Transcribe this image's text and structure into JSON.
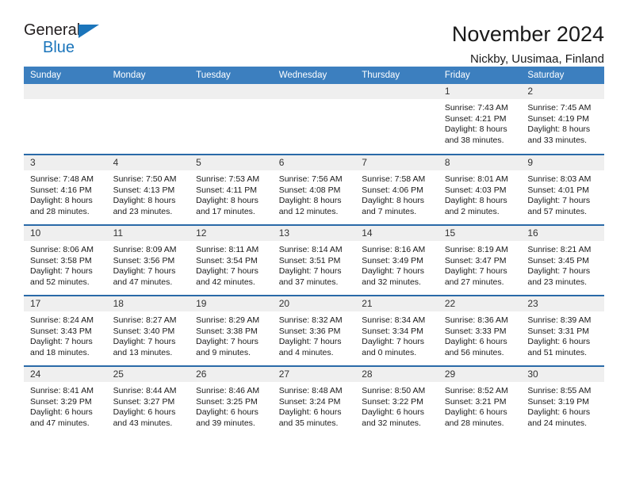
{
  "brand": {
    "name_part1": "General",
    "name_part2": "Blue",
    "accent_color": "#1b75bb"
  },
  "header": {
    "title": "November 2024",
    "subtitle": "Nickby, Uusimaa, Finland"
  },
  "theme": {
    "header_row_bg": "#3c7fbf",
    "row_divider": "#2a6aa8",
    "daynum_bg": "#efefef"
  },
  "weekday_headers": [
    "Sunday",
    "Monday",
    "Tuesday",
    "Wednesday",
    "Thursday",
    "Friday",
    "Saturday"
  ],
  "labels": {
    "sunrise_prefix": "Sunrise:",
    "sunset_prefix": "Sunset:",
    "daylight_prefix": "Daylight:"
  },
  "weeks": [
    [
      {
        "day": "",
        "sunrise": "",
        "sunset": "",
        "daylight_l1": "",
        "daylight_l2": ""
      },
      {
        "day": "",
        "sunrise": "",
        "sunset": "",
        "daylight_l1": "",
        "daylight_l2": ""
      },
      {
        "day": "",
        "sunrise": "",
        "sunset": "",
        "daylight_l1": "",
        "daylight_l2": ""
      },
      {
        "day": "",
        "sunrise": "",
        "sunset": "",
        "daylight_l1": "",
        "daylight_l2": ""
      },
      {
        "day": "",
        "sunrise": "",
        "sunset": "",
        "daylight_l1": "",
        "daylight_l2": ""
      },
      {
        "day": "1",
        "sunrise": "Sunrise: 7:43 AM",
        "sunset": "Sunset: 4:21 PM",
        "daylight_l1": "Daylight: 8 hours",
        "daylight_l2": "and 38 minutes."
      },
      {
        "day": "2",
        "sunrise": "Sunrise: 7:45 AM",
        "sunset": "Sunset: 4:19 PM",
        "daylight_l1": "Daylight: 8 hours",
        "daylight_l2": "and 33 minutes."
      }
    ],
    [
      {
        "day": "3",
        "sunrise": "Sunrise: 7:48 AM",
        "sunset": "Sunset: 4:16 PM",
        "daylight_l1": "Daylight: 8 hours",
        "daylight_l2": "and 28 minutes."
      },
      {
        "day": "4",
        "sunrise": "Sunrise: 7:50 AM",
        "sunset": "Sunset: 4:13 PM",
        "daylight_l1": "Daylight: 8 hours",
        "daylight_l2": "and 23 minutes."
      },
      {
        "day": "5",
        "sunrise": "Sunrise: 7:53 AM",
        "sunset": "Sunset: 4:11 PM",
        "daylight_l1": "Daylight: 8 hours",
        "daylight_l2": "and 17 minutes."
      },
      {
        "day": "6",
        "sunrise": "Sunrise: 7:56 AM",
        "sunset": "Sunset: 4:08 PM",
        "daylight_l1": "Daylight: 8 hours",
        "daylight_l2": "and 12 minutes."
      },
      {
        "day": "7",
        "sunrise": "Sunrise: 7:58 AM",
        "sunset": "Sunset: 4:06 PM",
        "daylight_l1": "Daylight: 8 hours",
        "daylight_l2": "and 7 minutes."
      },
      {
        "day": "8",
        "sunrise": "Sunrise: 8:01 AM",
        "sunset": "Sunset: 4:03 PM",
        "daylight_l1": "Daylight: 8 hours",
        "daylight_l2": "and 2 minutes."
      },
      {
        "day": "9",
        "sunrise": "Sunrise: 8:03 AM",
        "sunset": "Sunset: 4:01 PM",
        "daylight_l1": "Daylight: 7 hours",
        "daylight_l2": "and 57 minutes."
      }
    ],
    [
      {
        "day": "10",
        "sunrise": "Sunrise: 8:06 AM",
        "sunset": "Sunset: 3:58 PM",
        "daylight_l1": "Daylight: 7 hours",
        "daylight_l2": "and 52 minutes."
      },
      {
        "day": "11",
        "sunrise": "Sunrise: 8:09 AM",
        "sunset": "Sunset: 3:56 PM",
        "daylight_l1": "Daylight: 7 hours",
        "daylight_l2": "and 47 minutes."
      },
      {
        "day": "12",
        "sunrise": "Sunrise: 8:11 AM",
        "sunset": "Sunset: 3:54 PM",
        "daylight_l1": "Daylight: 7 hours",
        "daylight_l2": "and 42 minutes."
      },
      {
        "day": "13",
        "sunrise": "Sunrise: 8:14 AM",
        "sunset": "Sunset: 3:51 PM",
        "daylight_l1": "Daylight: 7 hours",
        "daylight_l2": "and 37 minutes."
      },
      {
        "day": "14",
        "sunrise": "Sunrise: 8:16 AM",
        "sunset": "Sunset: 3:49 PM",
        "daylight_l1": "Daylight: 7 hours",
        "daylight_l2": "and 32 minutes."
      },
      {
        "day": "15",
        "sunrise": "Sunrise: 8:19 AM",
        "sunset": "Sunset: 3:47 PM",
        "daylight_l1": "Daylight: 7 hours",
        "daylight_l2": "and 27 minutes."
      },
      {
        "day": "16",
        "sunrise": "Sunrise: 8:21 AM",
        "sunset": "Sunset: 3:45 PM",
        "daylight_l1": "Daylight: 7 hours",
        "daylight_l2": "and 23 minutes."
      }
    ],
    [
      {
        "day": "17",
        "sunrise": "Sunrise: 8:24 AM",
        "sunset": "Sunset: 3:43 PM",
        "daylight_l1": "Daylight: 7 hours",
        "daylight_l2": "and 18 minutes."
      },
      {
        "day": "18",
        "sunrise": "Sunrise: 8:27 AM",
        "sunset": "Sunset: 3:40 PM",
        "daylight_l1": "Daylight: 7 hours",
        "daylight_l2": "and 13 minutes."
      },
      {
        "day": "19",
        "sunrise": "Sunrise: 8:29 AM",
        "sunset": "Sunset: 3:38 PM",
        "daylight_l1": "Daylight: 7 hours",
        "daylight_l2": "and 9 minutes."
      },
      {
        "day": "20",
        "sunrise": "Sunrise: 8:32 AM",
        "sunset": "Sunset: 3:36 PM",
        "daylight_l1": "Daylight: 7 hours",
        "daylight_l2": "and 4 minutes."
      },
      {
        "day": "21",
        "sunrise": "Sunrise: 8:34 AM",
        "sunset": "Sunset: 3:34 PM",
        "daylight_l1": "Daylight: 7 hours",
        "daylight_l2": "and 0 minutes."
      },
      {
        "day": "22",
        "sunrise": "Sunrise: 8:36 AM",
        "sunset": "Sunset: 3:33 PM",
        "daylight_l1": "Daylight: 6 hours",
        "daylight_l2": "and 56 minutes."
      },
      {
        "day": "23",
        "sunrise": "Sunrise: 8:39 AM",
        "sunset": "Sunset: 3:31 PM",
        "daylight_l1": "Daylight: 6 hours",
        "daylight_l2": "and 51 minutes."
      }
    ],
    [
      {
        "day": "24",
        "sunrise": "Sunrise: 8:41 AM",
        "sunset": "Sunset: 3:29 PM",
        "daylight_l1": "Daylight: 6 hours",
        "daylight_l2": "and 47 minutes."
      },
      {
        "day": "25",
        "sunrise": "Sunrise: 8:44 AM",
        "sunset": "Sunset: 3:27 PM",
        "daylight_l1": "Daylight: 6 hours",
        "daylight_l2": "and 43 minutes."
      },
      {
        "day": "26",
        "sunrise": "Sunrise: 8:46 AM",
        "sunset": "Sunset: 3:25 PM",
        "daylight_l1": "Daylight: 6 hours",
        "daylight_l2": "and 39 minutes."
      },
      {
        "day": "27",
        "sunrise": "Sunrise: 8:48 AM",
        "sunset": "Sunset: 3:24 PM",
        "daylight_l1": "Daylight: 6 hours",
        "daylight_l2": "and 35 minutes."
      },
      {
        "day": "28",
        "sunrise": "Sunrise: 8:50 AM",
        "sunset": "Sunset: 3:22 PM",
        "daylight_l1": "Daylight: 6 hours",
        "daylight_l2": "and 32 minutes."
      },
      {
        "day": "29",
        "sunrise": "Sunrise: 8:52 AM",
        "sunset": "Sunset: 3:21 PM",
        "daylight_l1": "Daylight: 6 hours",
        "daylight_l2": "and 28 minutes."
      },
      {
        "day": "30",
        "sunrise": "Sunrise: 8:55 AM",
        "sunset": "Sunset: 3:19 PM",
        "daylight_l1": "Daylight: 6 hours",
        "daylight_l2": "and 24 minutes."
      }
    ]
  ]
}
